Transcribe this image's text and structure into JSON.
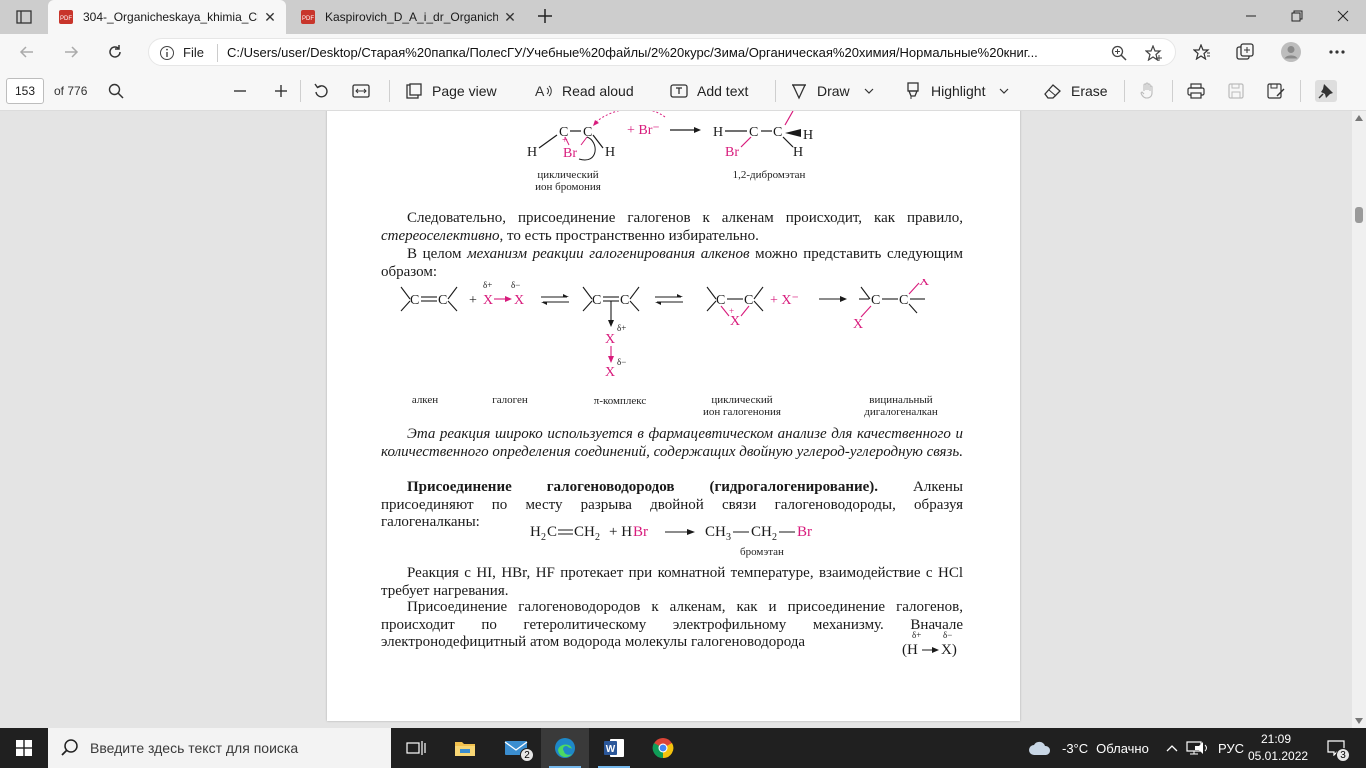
{
  "browser": {
    "tabs": [
      {
        "title": "304-_Organicheskaya_khimia_Ch",
        "active": true
      },
      {
        "title": "Kaspirovich_D_A_i_dr_Organiche",
        "active": false
      }
    ],
    "address": {
      "file_label": "File",
      "url": "C:/Users/user/Desktop/Старая%20папка/ПолесГУ/Учебные%20файлы/2%20курс/Зима/Органическая%20химия/Нормальные%20книг..."
    }
  },
  "pdf_toolbar": {
    "page_number": "153",
    "page_of": "of 776",
    "page_view": "Page view",
    "read_aloud": "Read aloud",
    "add_text": "Add text",
    "draw": "Draw",
    "highlight": "Highlight",
    "erase": "Erase"
  },
  "document": {
    "fig1": {
      "label_left": "циклический\nион бромония",
      "label_right": "1,2-дибромэтан",
      "plus_br": "+ Br⁻"
    },
    "p1_a": "Следовательно, присоединение галогенов к алкенам происходит, как правило, ",
    "p1_b": "стереоселективно",
    "p1_c": ", то есть пространственно избирательно.",
    "p2_a": "В целом ",
    "p2_b": "механизм реакции галогенирования алкенов",
    "p2_c": " можно представить следующим образом:",
    "fig2": {
      "labels": [
        "алкен",
        "галоген",
        "π-комплекс",
        "циклический\nион галогенония",
        "вицинальный\nдигалогеналкан"
      ],
      "plus_x": "+ X⁻"
    },
    "p3": "Эта реакция широко используется в фармацевтическом анализе для качественного и количественного определения соединений, содержащих двойную углерод-углеродную связь.",
    "p4_bold": "Присоединение галогеноводородов (гидрогалогенирование).",
    "p4_rest": " Алкены присоединяют по месту разрыва двойной связи галогеноводороды, образуя галогеналканы:",
    "eq_label": "бромэтан",
    "p5": "Реакция с HI, HBr, HF протекает при комнатной температуре, взаимодействие с HCl требует нагревания.",
    "p6": "Присоединение галогеноводородов к алкенам, как и присоединение галогенов, происходит по гетеролитическому электрофильному механизму. Вначале электронодефицитный атом водорода молекулы галогеноводорода"
  },
  "taskbar": {
    "search_placeholder": "Введите здесь текст для поиска",
    "weather_temp": "-3°C",
    "weather_text": "Облачно",
    "lang": "РУС",
    "time": "21:09",
    "date": "05.01.2022",
    "mail_badge": "2",
    "notif_badge": "3"
  },
  "colors": {
    "accent_magenta": "#d81b7c",
    "pdf_icon_red": "#c8352b",
    "taskbar": "#202020"
  }
}
